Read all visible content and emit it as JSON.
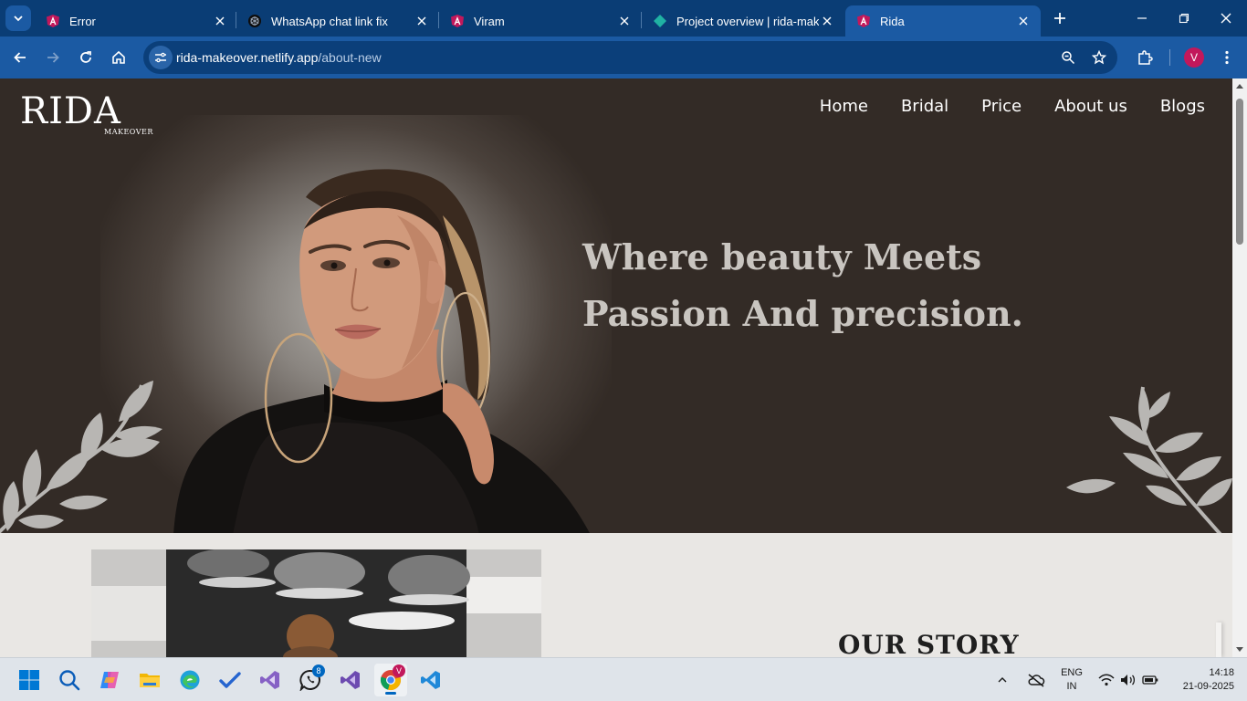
{
  "browser": {
    "tabs": [
      {
        "title": "Error",
        "favicon": "angular-icon",
        "active": false
      },
      {
        "title": "WhatsApp chat link fix",
        "favicon": "chatgpt-icon",
        "active": false
      },
      {
        "title": "Viram",
        "favicon": "angular-icon",
        "active": false
      },
      {
        "title": "Project overview | rida-makeover",
        "favicon": "netlify-icon",
        "active": false
      },
      {
        "title": "Rida",
        "favicon": "angular-icon",
        "active": true
      }
    ],
    "url_host": "rida-makeover.netlify.app",
    "url_path": "/about-new",
    "profile_initial": "V",
    "accent": "#1b5aa3"
  },
  "site": {
    "logo_main": "RIDA",
    "logo_sub": "MAKEOVER",
    "nav": [
      "Home",
      "Bridal",
      "Price",
      "About us",
      "Blogs"
    ],
    "hero_heading_line1": "Where beauty Meets",
    "hero_heading_line2": "Passion And precision.",
    "story_heading": "OUR STORY",
    "hero_bg": "#332b26"
  },
  "taskbar": {
    "apps": [
      "start-icon",
      "search-icon",
      "copilot-icon",
      "file-explorer-icon",
      "edge-icon",
      "todo-icon",
      "visual-studio-icon",
      "whatsapp-icon",
      "visual-studio-icon",
      "chrome-icon",
      "vscode-icon"
    ],
    "whatsapp_badge": "8",
    "chrome_badge": "V",
    "lang_line1": "ENG",
    "lang_line2": "IN",
    "time": "14:18",
    "date": "21-09-2025"
  }
}
